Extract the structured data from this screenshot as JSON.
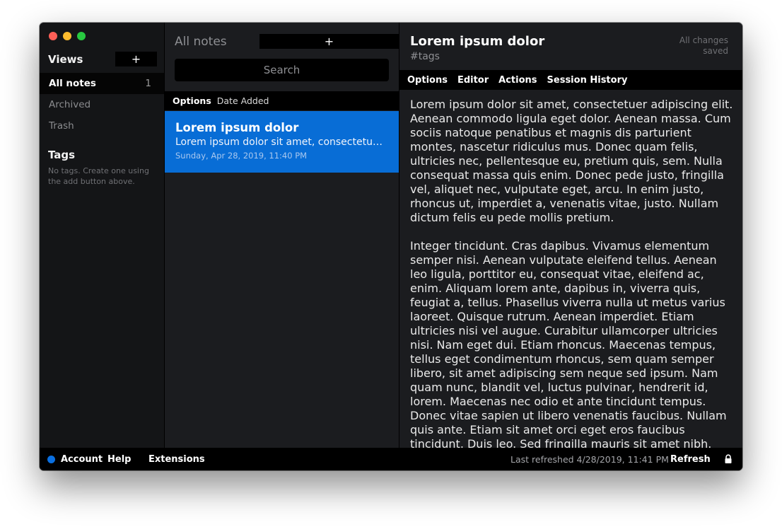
{
  "window": {
    "traffic_lights": [
      "close",
      "minimize",
      "maximize"
    ]
  },
  "sidebar": {
    "views_title": "Views",
    "add_label": "+",
    "items": [
      {
        "label": "All notes",
        "count": "1",
        "active": true
      },
      {
        "label": "Archived",
        "count": ""
      },
      {
        "label": "Trash",
        "count": ""
      }
    ],
    "tags_title": "Tags",
    "tags_empty": "No tags. Create one using the add button above."
  },
  "notes_list": {
    "title": "All notes",
    "add_label": "+",
    "search_placeholder": "Search",
    "options_label": "Options",
    "sort_label": "Date Added",
    "items": [
      {
        "title": "Lorem ipsum dolor",
        "preview": "Lorem ipsum dolor sit amet, consectetuer adipiscing elit.",
        "date": "Sunday, Apr 28, 2019, 11:40 PM",
        "selected": true
      }
    ]
  },
  "editor": {
    "title": "Lorem ipsum dolor",
    "tags": "#tags",
    "save_status": "All changes saved",
    "menu": [
      "Options",
      "Editor",
      "Actions",
      "Session History"
    ],
    "paragraphs": [
      "Lorem ipsum dolor sit amet, consectetuer adipiscing elit. Aenean commodo ligula eget dolor. Aenean massa. Cum sociis natoque penatibus et magnis dis parturient montes, nascetur ridiculus mus. Donec quam felis, ultricies nec, pellentesque eu, pretium quis, sem. Nulla consequat massa quis enim. Donec pede justo, fringilla vel, aliquet nec, vulputate eget, arcu. In enim justo, rhoncus ut, imperdiet a, venenatis vitae, justo. Nullam dictum felis eu pede mollis pretium.",
      "Integer tincidunt. Cras dapibus. Vivamus elementum semper nisi. Aenean vulputate eleifend tellus. Aenean leo ligula, porttitor eu, consequat vitae, eleifend ac, enim. Aliquam lorem ante, dapibus in, viverra quis, feugiat a, tellus. Phasellus viverra nulla ut metus varius laoreet. Quisque rutrum. Aenean imperdiet. Etiam ultricies nisi vel augue. Curabitur ullamcorper ultricies nisi. Nam eget dui. Etiam rhoncus. Maecenas tempus, tellus eget condimentum rhoncus, sem quam semper libero, sit amet adipiscing sem neque sed ipsum. Nam quam nunc, blandit vel, luctus pulvinar, hendrerit id, lorem. Maecenas nec odio et ante tincidunt tempus. Donec vitae sapien ut libero venenatis faucibus. Nullam quis ante. Etiam sit amet orci eget eros faucibus tincidunt. Duis leo. Sed fringilla mauris sit amet nibh."
    ]
  },
  "footer": {
    "account": "Account",
    "help": "Help",
    "extensions": "Extensions",
    "last_refreshed": "Last refreshed 4/28/2019, 11:41 PM",
    "refresh": "Refresh",
    "status_color": "#0a6fe0",
    "lock_icon": "lock-icon"
  },
  "colors": {
    "accent": "#086dd6",
    "background": "#1b1c1f",
    "sidebar": "#141517"
  }
}
